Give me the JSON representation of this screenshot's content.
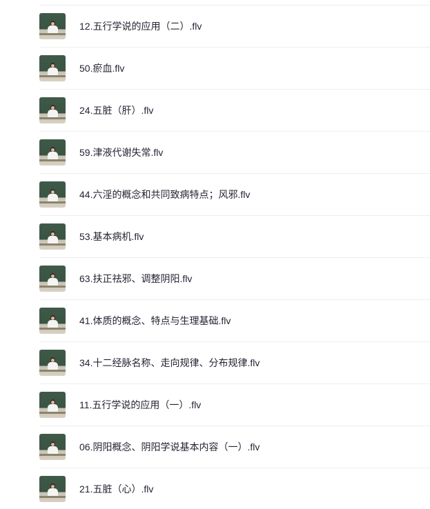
{
  "files": [
    {
      "name": "12.五行学说的应用（二）.flv",
      "thumbnail": "lecture-video-thumbnail"
    },
    {
      "name": "50.瘀血.flv",
      "thumbnail": "lecture-video-thumbnail"
    },
    {
      "name": "24.五脏（肝）.flv",
      "thumbnail": "lecture-video-thumbnail"
    },
    {
      "name": "59.津液代谢失常.flv",
      "thumbnail": "lecture-video-thumbnail"
    },
    {
      "name": "44.六淫的概念和共同致病特点；风邪.flv",
      "thumbnail": "lecture-video-thumbnail"
    },
    {
      "name": "53.基本病机.flv",
      "thumbnail": "lecture-video-thumbnail"
    },
    {
      "name": "63.扶正祛邪、调整阴阳.flv",
      "thumbnail": "lecture-video-thumbnail"
    },
    {
      "name": "41.体质的概念、特点与生理基础.flv",
      "thumbnail": "lecture-video-thumbnail"
    },
    {
      "name": "34.十二经脉名称、走向规律、分布规律.flv",
      "thumbnail": "lecture-video-thumbnail"
    },
    {
      "name": "11.五行学说的应用（一）.flv",
      "thumbnail": "lecture-video-thumbnail"
    },
    {
      "name": "06.阴阳概念、阴阳学说基本内容（一）.flv",
      "thumbnail": "lecture-video-thumbnail"
    },
    {
      "name": "21.五脏（心）.flv",
      "thumbnail": "lecture-video-thumbnail"
    }
  ],
  "colors": {
    "text": "#242433",
    "divider": "#eeeeee",
    "chalkboard": "#3f5a49"
  }
}
